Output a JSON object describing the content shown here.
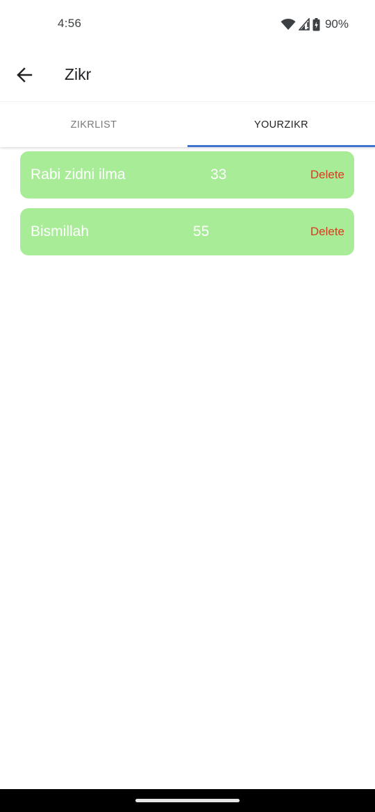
{
  "status_bar": {
    "time": "4:56",
    "battery_percent": "90%",
    "icons": [
      "wifi-icon",
      "signal-icon",
      "battery-icon"
    ]
  },
  "app_bar": {
    "title": "Zikr",
    "back_icon": "arrow-back-icon"
  },
  "tabs": [
    {
      "label": "ZIKRLIST",
      "active": false
    },
    {
      "label": "YOURZIKR",
      "active": true
    }
  ],
  "zikr_items": [
    {
      "name": "Rabi zidni ilma",
      "count": "33",
      "delete_label": "Delete"
    },
    {
      "name": "Bismillah",
      "count": "55",
      "delete_label": "Delete"
    }
  ],
  "colors": {
    "card_background": "#a8ec98",
    "delete_text": "#d83b1e",
    "tab_indicator": "#3f74d1"
  }
}
